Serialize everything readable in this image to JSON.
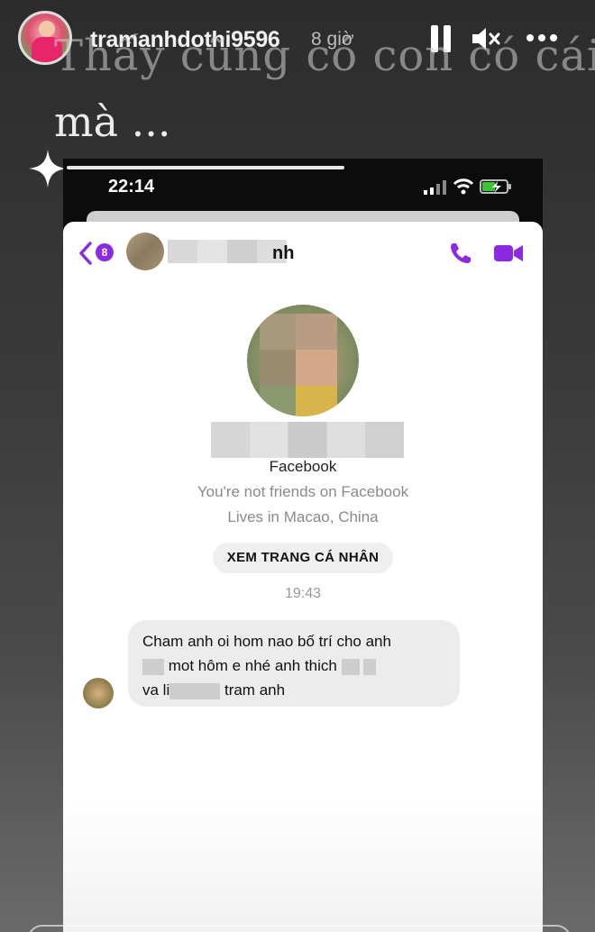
{
  "story": {
    "username": "tramanhdothi9596",
    "time_ago": "8 giờ",
    "caption_line1": "Thấy cũng có con có cái",
    "caption_line2": "mà ..."
  },
  "phone": {
    "clock": "22:14",
    "chat": {
      "back_badge": "8",
      "name_tail": "nh",
      "platform": "Facebook",
      "friend_status": "You're not friends on Facebook",
      "location": "Lives in Macao, China",
      "profile_button": "XEM TRANG CÁ NHÂN",
      "message_time": "19:43",
      "message": {
        "line1": "Cham anh oi hom nao bố trí cho anh",
        "line2_text": "mot hôm e nhé anh thich",
        "line3_start": "va li",
        "line3_end": "tram anh"
      }
    }
  },
  "colors": {
    "accent": "#8a2be2",
    "bubble": "#ececec"
  }
}
